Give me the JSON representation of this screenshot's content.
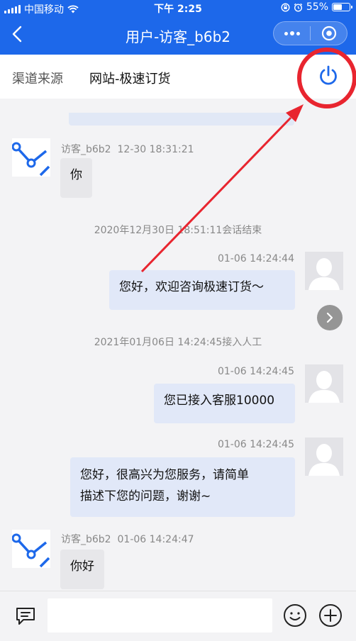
{
  "status_bar": {
    "carrier": "中国移动",
    "time": "下午 2:25",
    "battery": "55%",
    "battery_level": 0.55
  },
  "nav": {
    "title": "用户-访客_b6b2"
  },
  "source": {
    "label": "渠道来源",
    "value": "网站-极速订货"
  },
  "messages": {
    "m1": {
      "sender": "访客_b6b2",
      "time": "12-30 18:31:21",
      "text": "你"
    },
    "sys1": "2020年12月30日 18:51:11会话结束",
    "m2": {
      "time": "01-06 14:24:44",
      "text": "您好，欢迎咨询极速订货～"
    },
    "sys2": "2021年01月06日 14:24:45接入人工",
    "m3": {
      "time": "01-06 14:24:45",
      "text": "您已接入客服10000"
    },
    "m4": {
      "time": "01-06 14:24:45",
      "line1": "您好，很高兴为您服务，请简单",
      "line2": "描述下您的问题，谢谢~"
    },
    "m5": {
      "sender": "访客_b6b2",
      "time": "01-06 14:24:47",
      "text": "你好"
    }
  },
  "input": {
    "placeholder": ""
  },
  "colors": {
    "brand": "#1d68ea",
    "annotation": "#e8252f"
  }
}
